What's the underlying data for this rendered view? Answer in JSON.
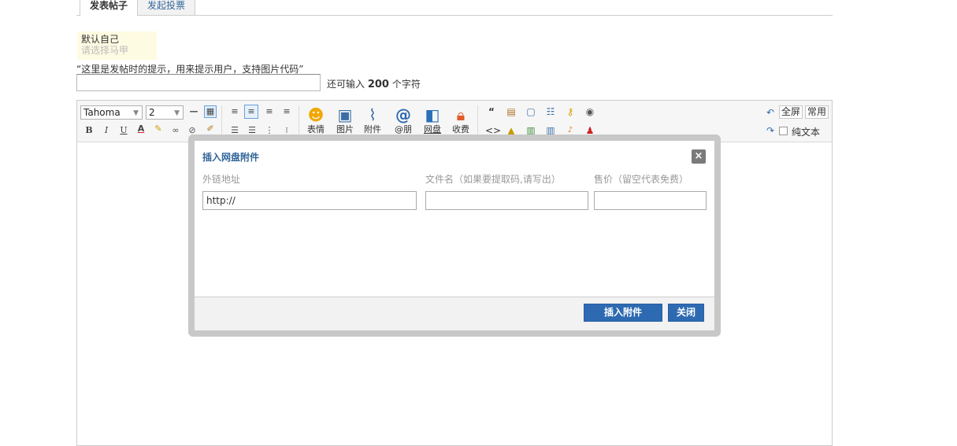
{
  "tabs": [
    {
      "label": "发表帖子",
      "active": true
    },
    {
      "label": "发起投票",
      "active": false
    }
  ],
  "identity": {
    "current": "默认自己",
    "placeholder": "请选择马甲"
  },
  "hint": "“这里是发帖时的提示，用来提示用户，支持图片代码”",
  "title_input": {
    "value": ""
  },
  "counter": {
    "prefix": "还可输入",
    "count": "200",
    "suffix": "个字符"
  },
  "toolbar": {
    "font_family": "Tahoma",
    "font_size": "2",
    "format_buttons": [
      "B",
      "I",
      "U",
      "A"
    ],
    "big_buttons": [
      {
        "label": "表情",
        "icon": "smiley-icon"
      },
      {
        "label": "图片",
        "icon": "image-icon"
      },
      {
        "label": "附件",
        "icon": "paperclip-icon"
      },
      {
        "label": "@朋",
        "icon": "at-icon"
      },
      {
        "label": "网盘",
        "icon": "netdisk-icon"
      },
      {
        "label": "收费",
        "icon": "lock-icon"
      }
    ],
    "fullscreen": "全屏",
    "common": "常用",
    "plain_text": "纯文本"
  },
  "dialog": {
    "title": "插入网盘附件",
    "fields": [
      {
        "label": "外链地址",
        "value": "http://"
      },
      {
        "label": "文件名（如果要提取码,请写出）",
        "value": ""
      },
      {
        "label": "售价（留空代表免费）",
        "value": ""
      }
    ],
    "insert_button": "插入附件",
    "close_button": "关闭"
  }
}
